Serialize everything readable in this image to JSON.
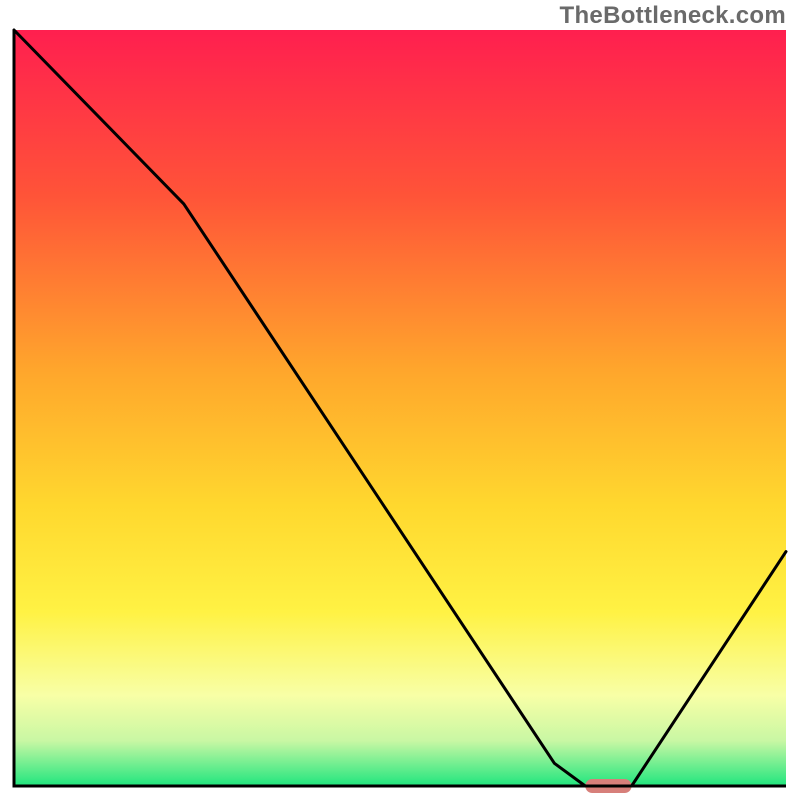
{
  "watermark": "TheBottleneck.com",
  "chart_data": {
    "type": "line",
    "title": "",
    "xlabel": "",
    "ylabel": "",
    "xlim": [
      0,
      100
    ],
    "ylim": [
      0,
      100
    ],
    "grid": false,
    "legend": false,
    "background": {
      "gradient_stops": [
        {
          "offset": 0,
          "color": "#ff1f4f"
        },
        {
          "offset": 22,
          "color": "#ff5438"
        },
        {
          "offset": 45,
          "color": "#ffa62c"
        },
        {
          "offset": 63,
          "color": "#ffd82e"
        },
        {
          "offset": 77,
          "color": "#fff244"
        },
        {
          "offset": 88,
          "color": "#f8ffa6"
        },
        {
          "offset": 94,
          "color": "#c9f7a4"
        },
        {
          "offset": 100,
          "color": "#20e67e"
        }
      ]
    },
    "series": [
      {
        "name": "bottleneck-curve",
        "color": "#000000",
        "width": 3,
        "x": [
          0,
          22,
          70,
          74,
          80,
          100
        ],
        "values": [
          100,
          77,
          3,
          0,
          0,
          31
        ]
      }
    ],
    "highlight_segment": {
      "name": "optimal-range",
      "color": "#d77f7a",
      "x_start": 74,
      "x_end": 80,
      "y": 0,
      "thickness_px": 14,
      "rounded": true
    }
  }
}
